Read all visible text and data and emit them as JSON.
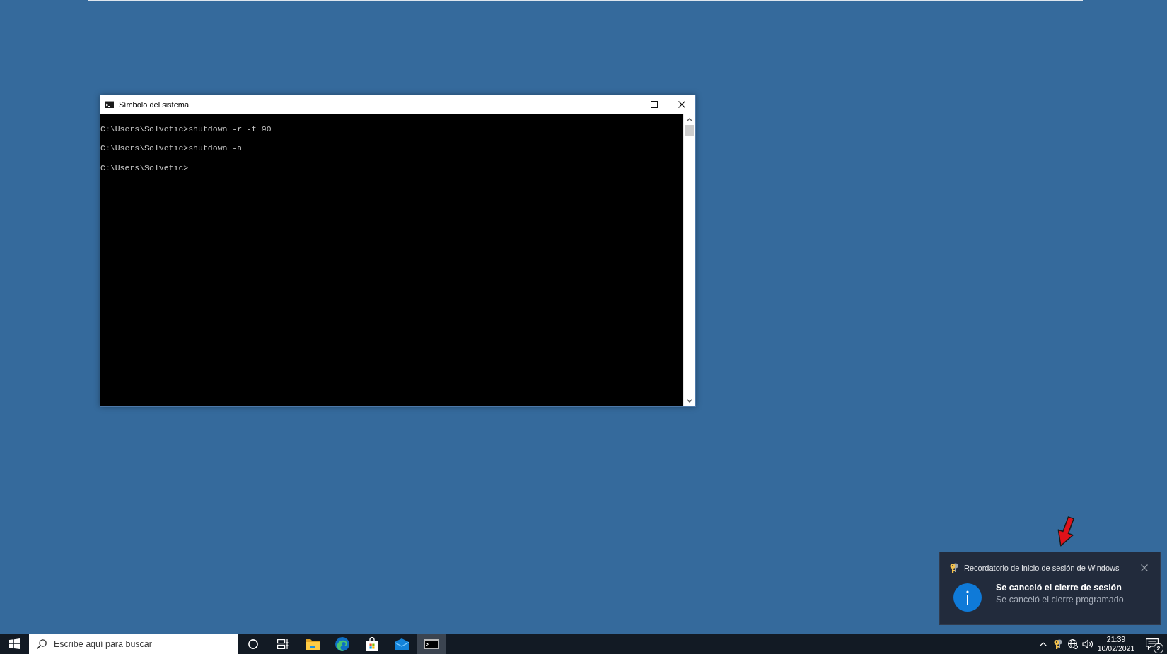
{
  "console_window": {
    "title": "Símbolo del sistema",
    "lines": [
      "C:\\Users\\Solvetic>shutdown -r -t 90",
      "C:\\Users\\Solvetic>shutdown -a",
      "C:\\Users\\Solvetic>"
    ]
  },
  "notification": {
    "app_name": "Recordatorio de inicio de sesión de Windows",
    "title": "Se canceló el cierre de sesión",
    "message": "Se canceló el cierre programado."
  },
  "taskbar": {
    "search": {
      "placeholder": "Escribe aquí para buscar"
    },
    "apps": [
      {
        "kind": "folder",
        "selected": false
      },
      {
        "kind": "browser",
        "selected": false
      },
      {
        "kind": "store",
        "selected": false
      },
      {
        "kind": "mail",
        "selected": false
      },
      {
        "kind": "terminal",
        "selected": true
      }
    ],
    "clock": {
      "time": "21:39",
      "date": "10/02/2021"
    },
    "notification_count": "2"
  }
}
